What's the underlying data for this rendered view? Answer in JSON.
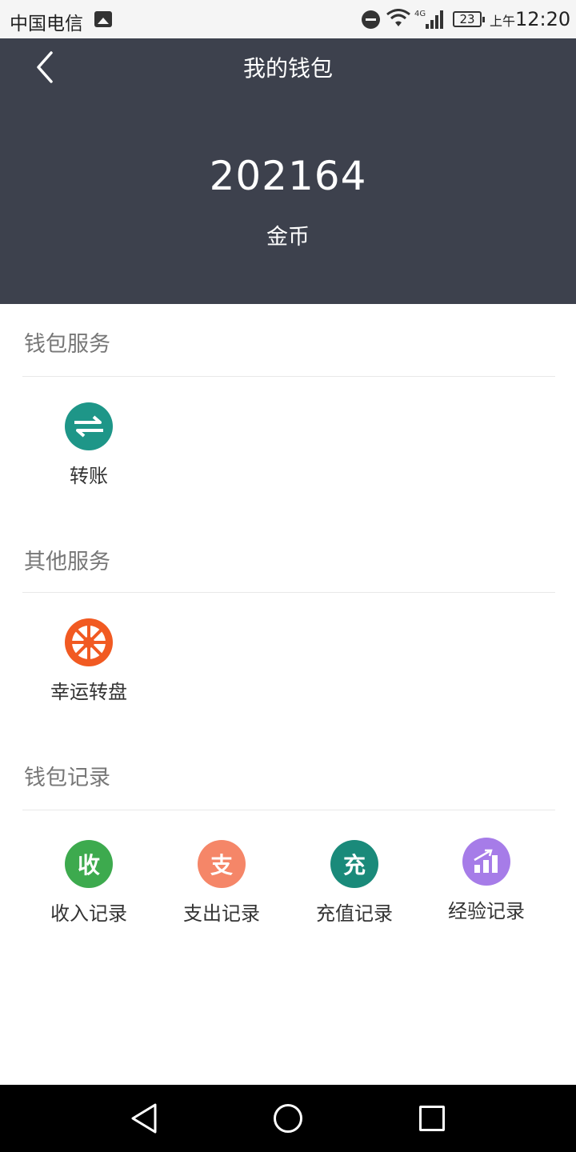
{
  "status_bar": {
    "carrier": "中国电信",
    "network": "4G",
    "battery": "23",
    "ampm": "上午",
    "time": "12:20"
  },
  "header": {
    "title": "我的钱包",
    "balance": "202164",
    "unit": "金币"
  },
  "sections": {
    "wallet_services": {
      "title": "钱包服务",
      "items": [
        {
          "label": "转账",
          "icon": "transfer-icon",
          "color": "#1e9688"
        }
      ]
    },
    "other_services": {
      "title": "其他服务",
      "items": [
        {
          "label": "幸运转盘",
          "icon": "lucky-wheel-icon",
          "color": "#f15a22"
        }
      ]
    },
    "wallet_records": {
      "title": "钱包记录",
      "items": [
        {
          "label": "收入记录",
          "icon_text": "收",
          "color": "#3daa4e"
        },
        {
          "label": "支出记录",
          "icon_text": "支",
          "color": "#f58668"
        },
        {
          "label": "充值记录",
          "icon_text": "充",
          "color": "#1a8a7a"
        },
        {
          "label": "经验记录",
          "icon": "chart-up-icon",
          "color": "#a67ce8"
        }
      ]
    }
  }
}
